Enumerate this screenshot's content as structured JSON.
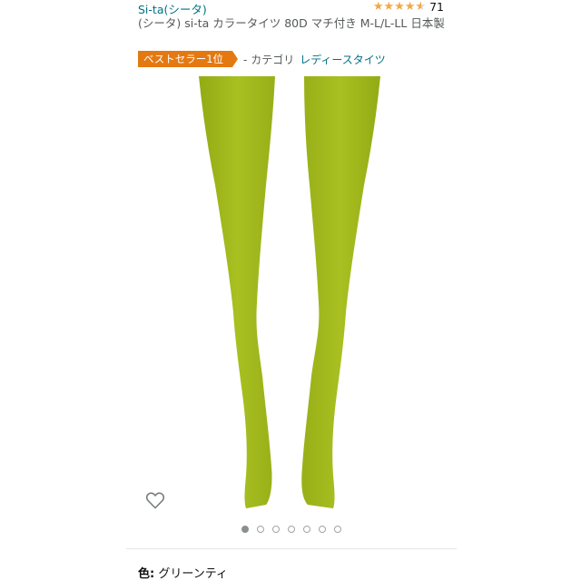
{
  "brand": {
    "label": "Si-ta(シータ)"
  },
  "rating": {
    "stars": 4.5,
    "count": "71"
  },
  "product": {
    "title": "(シータ) si-ta カラータイツ 80D マチ付き M-L/L-LL 日本製"
  },
  "bestseller": {
    "badge": "ベストセラー1位",
    "category_prefix": "- カテゴリ",
    "category": "レディースタイツ"
  },
  "image": {
    "icon": "wishlist-heart-icon",
    "carousel_total": 7,
    "carousel_active": 1
  },
  "variant": {
    "color_label": "色:",
    "color_value": "グリーンティ"
  },
  "colors": {
    "tights": "#a3bb1f",
    "tights_shadow": "#8fa613",
    "link": "#007185",
    "badge": "#e47911",
    "star": "#f3a847"
  }
}
